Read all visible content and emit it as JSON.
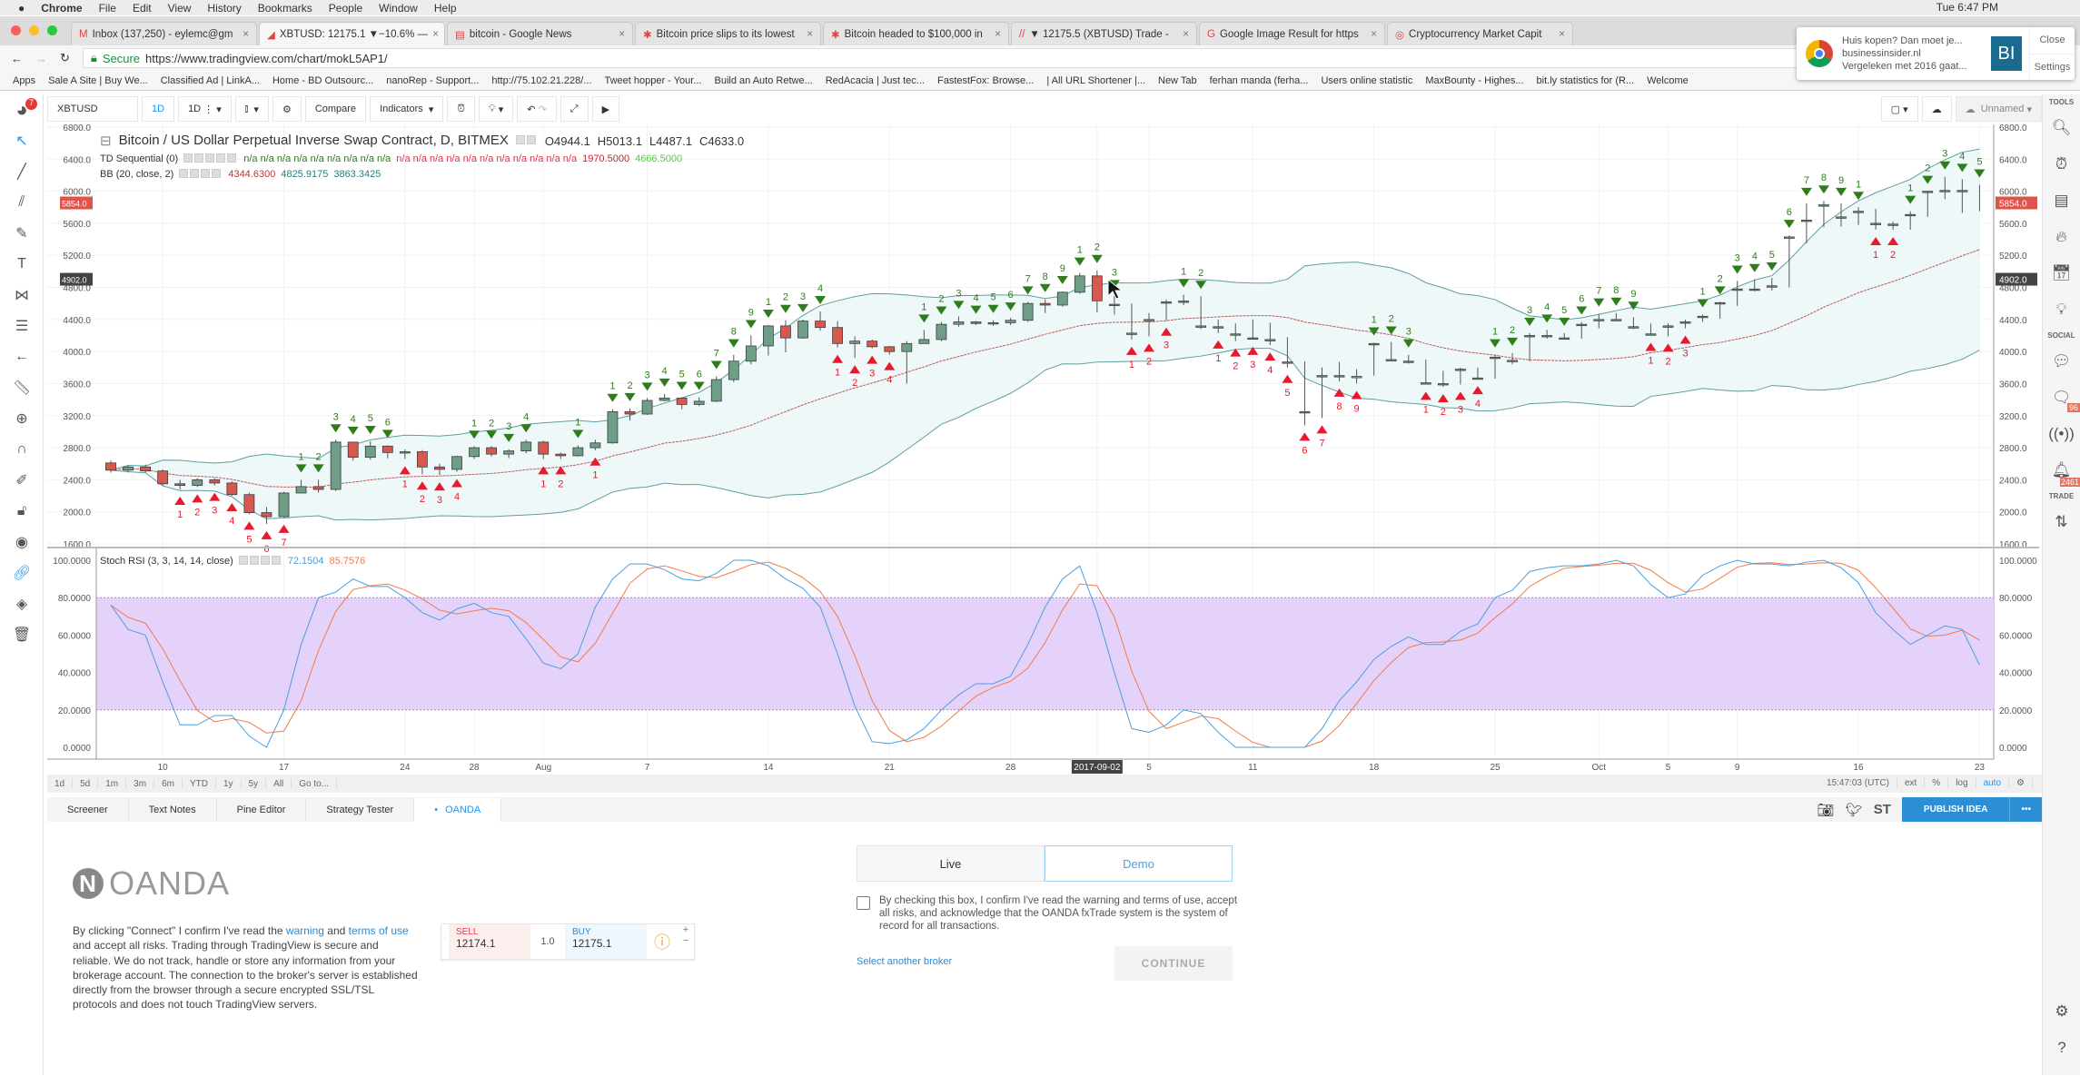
{
  "menubar": {
    "app": "Chrome",
    "items": [
      "File",
      "Edit",
      "View",
      "History",
      "Bookmarks",
      "People",
      "Window",
      "Help"
    ],
    "clock": "Tue 6:47 PM"
  },
  "tabs": [
    {
      "label": "Inbox (137,250) - eylemc@gm",
      "icon": "M"
    },
    {
      "label": "XBTUSD: 12175.1 ▼−10.6% —",
      "icon": "◢",
      "active": true
    },
    {
      "label": "bitcoin - Google News",
      "icon": "▤"
    },
    {
      "label": "Bitcoin price slips to its lowest",
      "icon": "✱"
    },
    {
      "label": "Bitcoin headed to $100,000 in",
      "icon": "✱"
    },
    {
      "label": "▼ 12175.5 (XBTUSD) Trade -",
      "icon": "//"
    },
    {
      "label": "Google Image Result for https",
      "icon": "G"
    },
    {
      "label": "Cryptocurrency Market Capit",
      "icon": "◎"
    }
  ],
  "address": {
    "secure": "Secure",
    "url": "https://www.tradingview.com/chart/mokL5AP1/"
  },
  "bookmarks": [
    "Apps",
    "Sale A Site | Buy We...",
    "Classified Ad | LinkA...",
    "Home - BD Outsourc...",
    "nanoRep - Support...",
    "http://75.102.21.228/...",
    "Tweet hopper - Your...",
    "Build an Auto Retwe...",
    "RedAcacia | Just tec...",
    "FastestFox: Browse...",
    "| All URL Shortener |...",
    "New Tab",
    "ferhan manda (ferha...",
    "Users online statistic",
    "MaxBounty - Highes...",
    "bit.ly statistics for (R...",
    "Welcome"
  ],
  "notification": {
    "title": "Huis kopen? Dan moet je...",
    "source": "businessinsider.nl",
    "body": "Vergeleken met 2016 gaat...",
    "logo": "BI",
    "close": "Close",
    "settings": "Settings"
  },
  "toolbar": {
    "symbol": "XBTUSD",
    "interval1": "1D",
    "interval2": "1D",
    "compare": "Compare",
    "indicators": "Indicators",
    "layout_name": "Unnamed",
    "alert_badge": "7"
  },
  "legend": {
    "title": "Bitcoin / US Dollar Perpetual Inverse Swap Contract, D, BITMEX",
    "o": "O4944.1",
    "h": "H5013.1",
    "l": "L4487.1",
    "c": "C4633.0",
    "td_label": "TD Sequential (0)",
    "td_values_green": "n/a n/a n/a n/a n/a n/a n/a n/a n/a",
    "td_values_red": "n/a n/a n/a n/a n/a n/a n/a n/a n/a n/a n/a",
    "td_v1": "1970.5000",
    "td_v2": "4666.5000",
    "bb_label": "BB (20, close, 2)",
    "bb_basis": "4344.6300",
    "bb_upper": "4825.9175",
    "bb_lower": "3863.3425",
    "stoch_label": "Stoch RSI (3, 3, 14, 14, close)",
    "stoch_k": "72.1504",
    "stoch_d": "85.7576"
  },
  "colors": {
    "up": "#6f9e88",
    "down": "#d6584f",
    "td_nine": "#5cff3a",
    "bb_fill": "#eaf6f6",
    "stoch_band": "#e5d2fb",
    "k": "#4a9fe0",
    "d": "#f07a4a",
    "sell_setup": "#2e7d1a",
    "buy_setup": "#e8192c",
    "accent": "#2c8fd6"
  },
  "chart_data": [
    {
      "type": "candlestick",
      "start_date": "2017-07-07",
      "interval": "1D",
      "open": [
        2610,
        2520,
        2560,
        2510,
        2350,
        2330,
        2400,
        2360,
        2215,
        1990,
        1940,
        2235,
        2315,
        2280,
        2870,
        2680,
        2820,
        2740,
        2750,
        2560,
        2530,
        2690,
        2800,
        2720,
        2760,
        2870,
        2720,
        2700,
        2800,
        2860,
        3250,
        3220,
        3390,
        3420,
        3340,
        3380,
        3650,
        3880,
        4070,
        4320,
        4170,
        4380,
        4300,
        4100,
        4130,
        4060,
        4000,
        4100,
        4150,
        4340,
        4370,
        4350,
        4360,
        4390,
        4600,
        4580,
        4740,
        4944,
        4590,
        4230,
        4400,
        4620,
        4630,
        4320,
        4310,
        4220,
        4170,
        4150,
        3870,
        3250,
        3700,
        3700,
        3690,
        4100,
        3900,
        3880,
        3610,
        3600,
        3780,
        3670,
        3930,
        3890,
        4200,
        4200,
        4170,
        4340,
        4400,
        4400,
        4310,
        4220,
        4320,
        4370,
        4440,
        4610,
        4780,
        4780,
        4820,
        5430,
        5640,
        5830,
        5680,
        5750,
        5600,
        5590,
        5710,
        6000,
        6010,
        6010
      ],
      "high": [
        2640,
        2580,
        2590,
        2530,
        2400,
        2420,
        2420,
        2380,
        2240,
        2060,
        2250,
        2400,
        2400,
        2900,
        2870,
        2880,
        2830,
        2780,
        2770,
        2600,
        2700,
        2820,
        2820,
        2780,
        2900,
        2890,
        2740,
        2830,
        2900,
        3280,
        3290,
        3420,
        3470,
        3430,
        3430,
        3690,
        3960,
        4200,
        4330,
        4390,
        4400,
        4500,
        4380,
        4190,
        4150,
        4070,
        4130,
        4270,
        4370,
        4440,
        4380,
        4390,
        4420,
        4620,
        4650,
        4750,
        4980,
        5013,
        4700,
        4600,
        4480,
        4650,
        4710,
        4690,
        4400,
        4350,
        4400,
        4360,
        4180,
        3880,
        3800,
        3870,
        3780,
        4110,
        4120,
        3960,
        3900,
        3760,
        3800,
        3800,
        3960,
        3980,
        4230,
        4270,
        4230,
        4370,
        4470,
        4480,
        4430,
        4350,
        4350,
        4400,
        4460,
        4620,
        4880,
        4900,
        4920,
        5450,
        5850,
        5880,
        5850,
        5800,
        5780,
        5620,
        5750,
        6000,
        6180,
        6150,
        6080
      ],
      "low": [
        2490,
        2490,
        2490,
        2330,
        2280,
        2310,
        2330,
        2200,
        1970,
        1850,
        1930,
        2230,
        2240,
        2260,
        2640,
        2650,
        2670,
        2660,
        2470,
        2460,
        2500,
        2660,
        2690,
        2670,
        2730,
        2660,
        2660,
        2690,
        2770,
        2850,
        3140,
        3210,
        3380,
        3280,
        3320,
        3370,
        3620,
        3840,
        3950,
        3990,
        4160,
        4260,
        4050,
        3920,
        4040,
        3960,
        3600,
        4100,
        4130,
        4310,
        4330,
        4320,
        4330,
        4370,
        4480,
        4560,
        4720,
        4487,
        4460,
        4150,
        4190,
        4390,
        4580,
        4280,
        4230,
        4130,
        4150,
        4080,
        3800,
        3080,
        3170,
        3630,
        3600,
        3700,
        3880,
        3850,
        3590,
        3560,
        3590,
        3660,
        3660,
        3840,
        3880,
        4160,
        4150,
        4160,
        4290,
        4380,
        4280,
        4200,
        4190,
        4290,
        4370,
        4410,
        4570,
        4750,
        4760,
        4800,
        5350,
        5550,
        5560,
        5580,
        5520,
        5520,
        5520,
        5680,
        5900,
        5730,
        5750
      ],
      "close": [
        2520,
        2560,
        2510,
        2350,
        2330,
        2400,
        2360,
        2215,
        1990,
        1940,
        2235,
        2315,
        2280,
        2870,
        2680,
        2820,
        2740,
        2750,
        2560,
        2530,
        2690,
        2800,
        2720,
        2760,
        2870,
        2720,
        2700,
        2800,
        2860,
        3250,
        3220,
        3390,
        3420,
        3340,
        3380,
        3650,
        3880,
        4070,
        4320,
        4170,
        4380,
        4300,
        4100,
        4130,
        4060,
        4000,
        4100,
        4150,
        4340,
        4370,
        4350,
        4360,
        4390,
        4600,
        4580,
        4740,
        4944,
        4633,
        4590,
        4230,
        4400,
        4620,
        4630,
        4320,
        4310,
        4220,
        4170,
        4150,
        3870,
        3250,
        3700,
        3700,
        3690,
        4100,
        3900,
        3880,
        3610,
        3600,
        3780,
        3670,
        3930,
        3890,
        4200,
        4200,
        4170,
        4340,
        4400,
        4400,
        4310,
        4220,
        4320,
        4370,
        4440,
        4610,
        4780,
        4780,
        4820,
        5430,
        5640,
        5830,
        5680,
        5750,
        5600,
        5590,
        5710,
        6000,
        6010,
        6010,
        5854
      ],
      "ylim": [
        1600,
        6800
      ],
      "yticks": [
        "6800.0",
        "6400.0",
        "6000.0",
        "5600.0",
        "5200.0",
        "4800.0",
        "4400.0",
        "4000.0",
        "3600.0",
        "3200.0",
        "2800.0",
        "2400.0",
        "2000.0",
        "1600.0"
      ],
      "last_price_label": "5854.0",
      "crosshair_price_label": "4902.0",
      "indicators": [
        "TD Sequential",
        "Bollinger Bands (20, 2)"
      ]
    },
    {
      "type": "line",
      "name": "Stoch RSI",
      "ylim": [
        0,
        100
      ],
      "yticks": [
        "100.0000",
        "80.0000",
        "60.0000",
        "40.0000",
        "20.0000",
        "0.0000"
      ],
      "band": [
        20,
        80
      ],
      "k": [
        76,
        63,
        60,
        35,
        12,
        12,
        17,
        17,
        6,
        0,
        20,
        55,
        80,
        83,
        90,
        86,
        86,
        80,
        72,
        68,
        74,
        77,
        72,
        70,
        58,
        45,
        42,
        50,
        75,
        90,
        98,
        98,
        95,
        90,
        89,
        93,
        100,
        100,
        97,
        90,
        85,
        75,
        50,
        22,
        3,
        2,
        4,
        10,
        20,
        28,
        34,
        34,
        38,
        55,
        75,
        90,
        97,
        72,
        40,
        10,
        8,
        12,
        20,
        18,
        8,
        0,
        0,
        0,
        0,
        0,
        10,
        25,
        35,
        47,
        54,
        59,
        55,
        55,
        62,
        66,
        80,
        84,
        94,
        96,
        97,
        97,
        98,
        100,
        97,
        87,
        80,
        82,
        92,
        97,
        100,
        98,
        98,
        97,
        99,
        100,
        96,
        88,
        72,
        63,
        55,
        60,
        65,
        63,
        44
      ]
    },
    {
      "type": "axis",
      "xticks": [
        {
          "date": "2017-07-10",
          "label": "10"
        },
        {
          "date": "2017-07-17",
          "label": "17"
        },
        {
          "date": "2017-07-24",
          "label": "24"
        },
        {
          "date": "2017-07-28",
          "label": "28"
        },
        {
          "date": "2017-08-01",
          "label": "Aug"
        },
        {
          "date": "2017-08-07",
          "label": "7"
        },
        {
          "date": "2017-08-14",
          "label": "14"
        },
        {
          "date": "2017-08-21",
          "label": "21"
        },
        {
          "date": "2017-08-28",
          "label": "28"
        },
        {
          "date": "2017-09-02",
          "label": "2017-09-02",
          "highlight": true
        },
        {
          "date": "2017-09-05",
          "label": "5"
        },
        {
          "date": "2017-09-11",
          "label": "11"
        },
        {
          "date": "2017-09-18",
          "label": "18"
        },
        {
          "date": "2017-09-25",
          "label": "25"
        },
        {
          "date": "2017-10-01",
          "label": "Oct"
        },
        {
          "date": "2017-10-05",
          "label": "5"
        },
        {
          "date": "2017-10-09",
          "label": "9"
        },
        {
          "date": "2017-10-16",
          "label": "16"
        },
        {
          "date": "2017-10-23",
          "label": "23"
        }
      ]
    }
  ],
  "range": {
    "buttons": [
      "1d",
      "5d",
      "1m",
      "3m",
      "6m",
      "YTD",
      "1y",
      "5y",
      "All",
      "Go to..."
    ],
    "time": "15:47:03 (UTC)",
    "right": [
      "ext",
      "%",
      "log",
      "auto"
    ]
  },
  "bottom_tabs": [
    "Screener",
    "Text Notes",
    "Pine Editor",
    "Strategy Tester",
    "OANDA"
  ],
  "publish": "PUBLISH IDEA",
  "share": {
    "st": "ST"
  },
  "oanda": {
    "logo": "OANDA",
    "disc1": "By clicking \"Connect\" I confirm I've read the ",
    "warning": "warning",
    "and": " and ",
    "terms": "terms of use",
    "disc2": " and accept all risks. Trading through TradingView is secure and reliable. We do not track, handle or store any information from your brokerage account. The connection to the broker's server is established directly from the browser through a secure encrypted SSL/TSL protocols and does not touch TradingView servers.",
    "sell_label": "SELL",
    "sell_price": "12174.1",
    "qty": "1.0",
    "buy_label": "BUY",
    "buy_price": "12175.1",
    "live": "Live",
    "demo": "Demo",
    "agree": "By checking this box, I confirm I've read the warning and terms of use, accept all risks, and acknowledge that the OANDA fxTrade system is the system of record for all transactions.",
    "other_broker": "Select another broker",
    "continue": "CONTINUE"
  },
  "sidebar": {
    "tools": "TOOLS",
    "social": "SOCIAL",
    "trade": "TRADE",
    "badge1": "96",
    "badge2": "2461"
  }
}
